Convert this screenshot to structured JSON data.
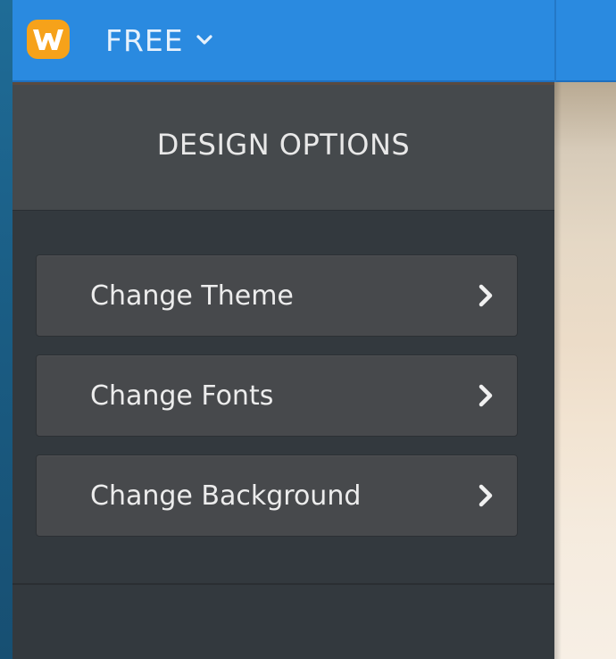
{
  "topbar": {
    "logo_letter": "W",
    "plan_label": "FREE"
  },
  "design_panel": {
    "title": "DESIGN OPTIONS",
    "options": [
      {
        "label": "Change Theme"
      },
      {
        "label": "Change Fonts"
      },
      {
        "label": "Change Background"
      }
    ]
  },
  "colors": {
    "topbar": "#2a8ae0",
    "panel_bg": "#33393e",
    "panel_header": "#45494c",
    "option_bg": "#47494c",
    "logo_orange": "#f6a21a"
  }
}
